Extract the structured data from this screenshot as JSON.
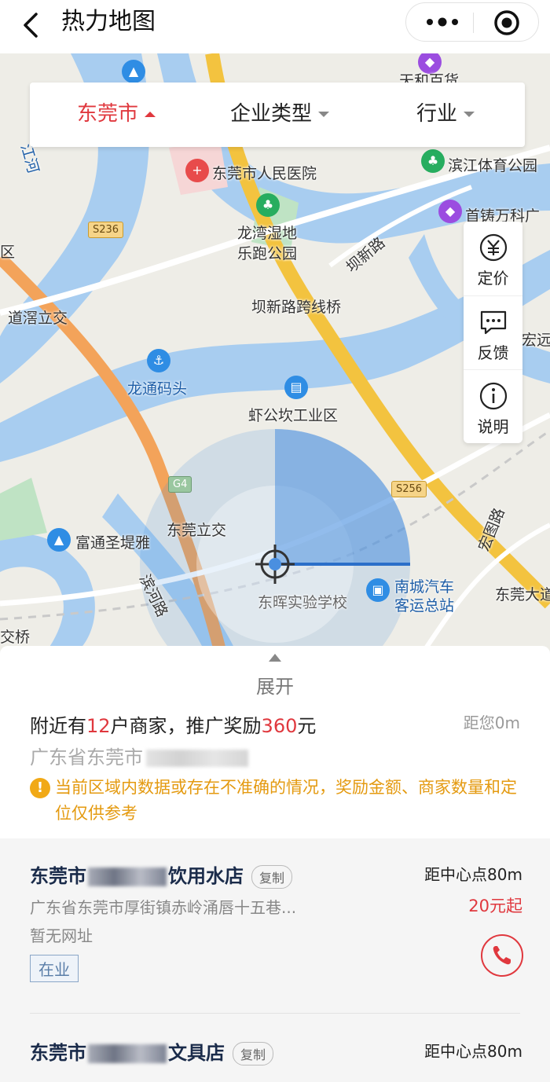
{
  "header": {
    "title": "热力地图",
    "back_icon": "chevron-left-icon",
    "more_icon": "more-dots-icon",
    "close_icon": "target-circle-icon"
  },
  "filters": [
    {
      "label": "东莞市",
      "active": true
    },
    {
      "label": "企业类型",
      "active": false
    },
    {
      "label": "行业",
      "active": false
    }
  ],
  "side_buttons": [
    {
      "label": "定价",
      "icon": "yuan-icon"
    },
    {
      "label": "反馈",
      "icon": "feedback-icon"
    },
    {
      "label": "说明",
      "icon": "info-icon"
    }
  ],
  "map": {
    "labels": {
      "hospital": "东莞市人民医院",
      "stadium": "滨江体育公园",
      "wanke": "首铸万科广",
      "wetland1": "龙湾湿地",
      "wetland2": "乐跑公园",
      "banxinlu": "坝新路",
      "bridge": "坝新路跨线桥",
      "daoxi": "道滘立交",
      "longtong": "龙通码头",
      "xiagong": "虾公坎工业区",
      "dongguan_lijiao": "东莞立交",
      "futong": "富通圣堤雅",
      "binhe": "滨河路",
      "donghui": "东晖实验学校",
      "nancheng1": "南城汽车",
      "nancheng2": "客运总站",
      "donghuan": "东莞大道",
      "hongtu": "宏图路",
      "jiaoqiao": "交桥",
      "qu": "区",
      "tianhe": "天和百货",
      "jiang": "江河",
      "yuan": "宏远",
      "s236": "S236",
      "s256": "S256",
      "g4": "G4"
    }
  },
  "panel": {
    "expand_label": "展开",
    "summary_prefix": "附近有",
    "summary_count": "12",
    "summary_mid": "户商家，推广奖励",
    "summary_reward": "360",
    "summary_suffix": "元",
    "distance_you": "距您0m",
    "address": "广东省东莞市",
    "notice": "当前区域内数据或存在不准确的情况，奖励金额、商家数量和定位仅供参考"
  },
  "merchants": [
    {
      "name_prefix": "东莞市",
      "name_suffix": "饮用水店",
      "copy": "复制",
      "distance": "距中心点80m",
      "address": "广东省东莞市厚街镇赤岭涌唇十五巷...",
      "price": "20元起",
      "website": "暂无网址",
      "status": "在业"
    },
    {
      "name_prefix": "东莞市",
      "name_suffix": "文具店",
      "copy": "复制",
      "distance": "距中心点80m"
    }
  ],
  "colors": {
    "accent_red": "#e0383e",
    "warning_orange": "#e49a10",
    "heat_blue": "#4a8fe0"
  }
}
